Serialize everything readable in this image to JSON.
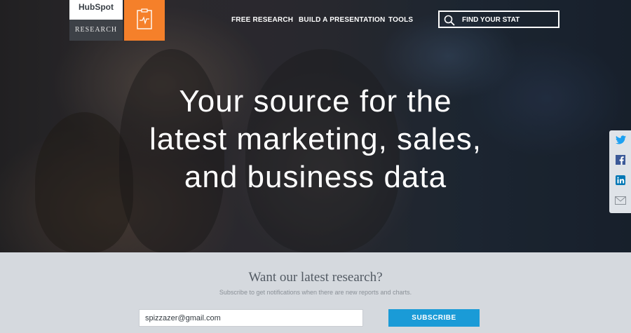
{
  "brand": {
    "logo": "HubSpot",
    "section": "RESEARCH",
    "accent_color": "#f5802a",
    "logo_icon": "clipboard-chart-icon"
  },
  "nav": {
    "items": [
      {
        "label": "FREE RESEARCH"
      },
      {
        "label": "BUILD A PRESENTATION"
      },
      {
        "label": "TOOLS"
      }
    ],
    "search_label": "FIND YOUR STAT",
    "search_icon": "search-icon"
  },
  "hero": {
    "headline_line1": "Your source for the",
    "headline_line2": "latest marketing, sales,",
    "headline_line3": "and business data"
  },
  "share": {
    "icons": [
      "twitter-icon",
      "facebook-icon",
      "linkedin-icon",
      "email-icon"
    ]
  },
  "subscribe": {
    "title": "Want our latest research?",
    "text": "Subscribe to get notifications when there are new reports and charts.",
    "email_value": "spizzazer@gmail.com",
    "button_label": "SUBSCRIBE",
    "button_color": "#1a9bd7"
  }
}
